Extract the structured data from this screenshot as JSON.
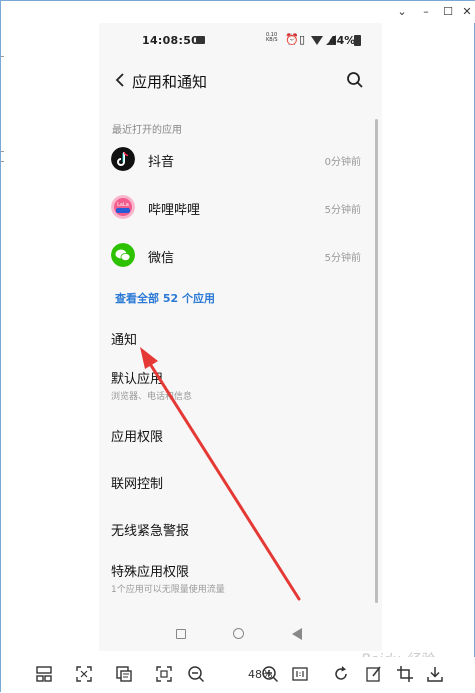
{
  "window": {
    "controls": [
      "chevron-down",
      "minimize",
      "maximize",
      "close"
    ]
  },
  "status_bar": {
    "time": "14:08:50",
    "mini_text_top": "0.10",
    "mini_text_bottom": "KB/S",
    "battery": "44%"
  },
  "app_bar": {
    "title": "应用和通知",
    "back_icon": "back-chevron-icon",
    "search_icon": "search-icon"
  },
  "recent_apps": {
    "header": "最近打开的应用",
    "items": [
      {
        "name": "抖音",
        "time": "0分钟前",
        "icon_color": "#111111"
      },
      {
        "name": "哔哩哔哩",
        "time": "5分钟前",
        "icon_color": "#f25d8e"
      },
      {
        "name": "微信",
        "time": "5分钟前",
        "icon_color": "#2dc100"
      }
    ],
    "see_all": "查看全部 52 个应用"
  },
  "menu": [
    {
      "title": "通知",
      "subtitle": ""
    },
    {
      "title": "默认应用",
      "subtitle": "浏览器、电话和信息"
    },
    {
      "title": "应用权限",
      "subtitle": ""
    },
    {
      "title": "联网控制",
      "subtitle": ""
    },
    {
      "title": "无线紧急警报",
      "subtitle": ""
    },
    {
      "title": "特殊应用权限",
      "subtitle": "1个应用可以无限量使用流量"
    }
  ],
  "toolbar": {
    "zoom": "48%",
    "watermark": "Baidu 经验"
  },
  "colors": {
    "accent_link": "#2c7ad6",
    "annotation_arrow": "#e53935"
  }
}
